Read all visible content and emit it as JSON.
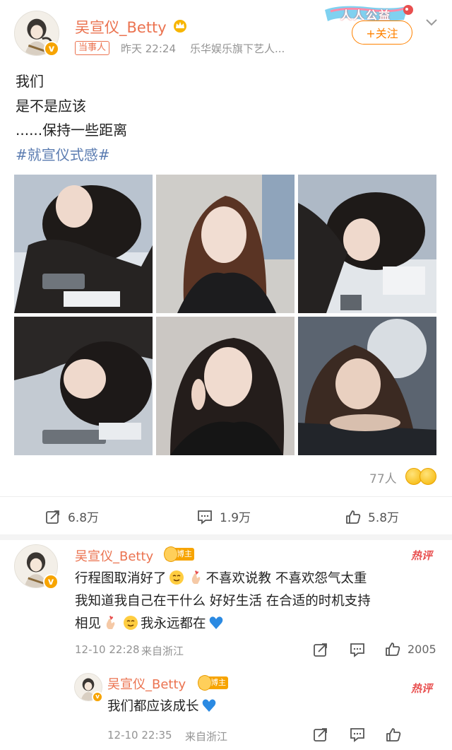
{
  "post": {
    "author": "吴宣仪_Betty",
    "tag": "当事人",
    "time": "昨天 22:24",
    "source": "乐华娱乐旗下艺人...",
    "banner": "人人公益",
    "follow": "+关注",
    "lines": [
      "我们",
      "是不是应该",
      "......保持一些距离"
    ],
    "hashtag": "#就宣仪式感#",
    "photos": [
      {
        "name": "photo-1"
      },
      {
        "name": "photo-2"
      },
      {
        "name": "photo-3"
      },
      {
        "name": "photo-4"
      },
      {
        "name": "photo-5"
      },
      {
        "name": "photo-6"
      }
    ],
    "reactions": "77人"
  },
  "actions": {
    "repost": "6.8万",
    "comment": "1.9万",
    "like": "5.8万"
  },
  "comments": [
    {
      "author": "吴宣仪_Betty",
      "badge": "博主",
      "hot": "热评",
      "lines": [
        "行程图取消好了",
        "不喜欢说教 不喜欢怨气太重",
        "我知道我自己在干什么 好好生活 在合适的时机支持",
        "相见",
        "我永远都在"
      ],
      "time": "12-10 22:28",
      "location": "来自浙江",
      "likes": "2005"
    },
    {
      "author": "吴宣仪_Betty",
      "badge": "博主",
      "hot": "热评",
      "text": "我们都应该成长",
      "time": "12-10 22:35",
      "location": "来自浙江"
    }
  ],
  "colors": {
    "username": "#eb7350",
    "follow": "#ff8200",
    "hashtag": "#5b7cb1",
    "badge": "#f7a400",
    "hot": "#e84f4f"
  }
}
